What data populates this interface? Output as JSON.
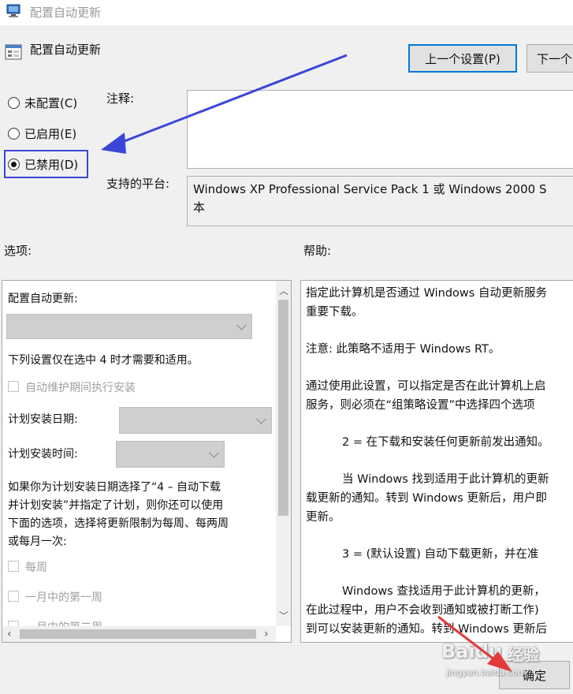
{
  "window": {
    "title": "配置自动更新"
  },
  "header": {
    "title": "配置自动更新"
  },
  "buttons": {
    "prev": "上一个设置(P)",
    "next": "下一个",
    "ok": "确定"
  },
  "state_options": [
    {
      "label": "未配置(C)",
      "checked": false
    },
    {
      "label": "已启用(E)",
      "checked": false
    },
    {
      "label": "已禁用(D)",
      "checked": true
    }
  ],
  "comment": {
    "label": "注释:",
    "value": ""
  },
  "platform": {
    "label": "支持的平台:",
    "line1": "Windows XP Professional Service Pack 1 或 Windows 2000 S",
    "line2": "本"
  },
  "options": {
    "label": "选项:",
    "heading": "配置自动更新:",
    "note": "下列设置仅在选中 4 时才需要和适用。",
    "maintenance_checkbox": "自动维护期间执行安装",
    "schedule_day_label": "计划安装日期:",
    "schedule_time_label": "计划安装时间:",
    "desc": [
      "如果你为计划安装日期选择了“4 – 自动下载",
      "并计划安装”并指定了计划，则你还可以使用",
      "下面的选项，选择将更新限制为每周、每两周",
      "或每月一次:"
    ],
    "weekly": "每周",
    "first_week": "一月中的第一周",
    "second_week": "一月中的第二周"
  },
  "help": {
    "label": "帮助:",
    "lines": [
      "指定此计算机是否通过 Windows 自动更新服务",
      "重要下载。",
      "注意: 此策略不适用于 Windows RT。",
      "通过使用此设置，可以指定是否在此计算机上启",
      "服务，则必须在“组策略设置”中选择四个选项",
      "2 = 在下载和安装任何更新前发出通知。",
      "当 Windows 找到适用于此计算机的更新",
      "载更新的通知。转到 Windows 更新后，用户即",
      "更新。",
      "3 = (默认设置) 自动下载更新，并在准",
      "Windows 查找适用于此计算机的更新，",
      "在此过程中，用户不会收到通知或被打断工作)",
      "到可以安装更新的通知。转到 Windows 更新后"
    ]
  },
  "watermark": {
    "brand": "Baidu",
    "brand2": "经验",
    "url": "jingyan.baidu.com"
  },
  "colors": {
    "highlight": "#3b46d8",
    "arrow_blue": "#3b46d8",
    "arrow_red": "#e23b3b",
    "focus": "#0078d7"
  }
}
